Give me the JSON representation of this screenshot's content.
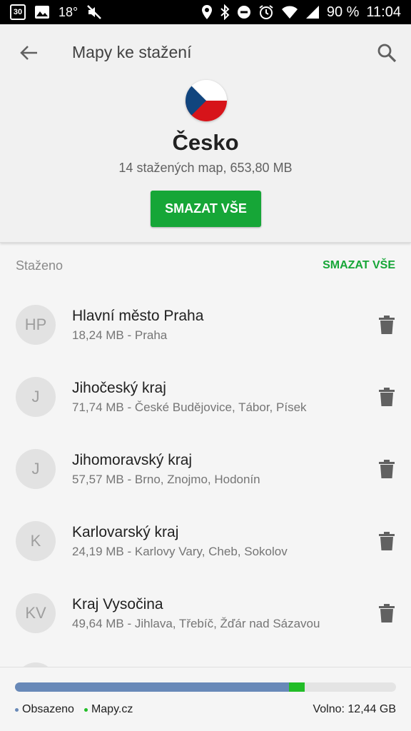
{
  "status_bar": {
    "calendar_day": "30",
    "temperature": "18°",
    "battery": "90 %",
    "time": "11:04",
    "icons": [
      "calendar-icon",
      "image-icon",
      "mute-icon",
      "location-icon",
      "bluetooth-icon",
      "do-not-disturb-icon",
      "alarm-icon",
      "wifi-icon",
      "signal-icon",
      "battery-icon"
    ]
  },
  "header": {
    "title": "Mapy ke stažení",
    "country": "Česko",
    "summary": "14 stažených map, 653,80 MB",
    "delete_all_label": "SMAZAT VŠE",
    "flag_colors": {
      "white": "#ffffff",
      "red": "#d7141a",
      "blue": "#11457e"
    }
  },
  "section": {
    "title": "Staženo",
    "delete_all_label": "SMAZAT VŠE"
  },
  "maps": [
    {
      "initials": "HP",
      "name": "Hlavní město Praha",
      "details": "18,24 MB - Praha"
    },
    {
      "initials": "J",
      "name": "Jihočeský kraj",
      "details": "71,74 MB - České Budějovice, Tábor, Písek"
    },
    {
      "initials": "J",
      "name": "Jihomoravský kraj",
      "details": "57,57 MB - Brno, Znojmo, Hodonín"
    },
    {
      "initials": "K",
      "name": "Karlovarský kraj",
      "details": "24,19 MB - Karlovy Vary, Cheb, Sokolov"
    },
    {
      "initials": "KV",
      "name": "Kraj Vysočina",
      "details": "49,64 MB - Jihlava, Třebíč, Žďár nad Sázavou"
    }
  ],
  "storage": {
    "used_fraction": 0.72,
    "app_fraction": 0.04,
    "used_label": "Obsazeno",
    "app_label": "Mapy.cz",
    "free_label": "Volno: 12,44 GB",
    "colors": {
      "used": "#6889b8",
      "app": "#22bd27",
      "free": "#e4e4e4"
    }
  },
  "colors": {
    "accent": "#16a637"
  }
}
